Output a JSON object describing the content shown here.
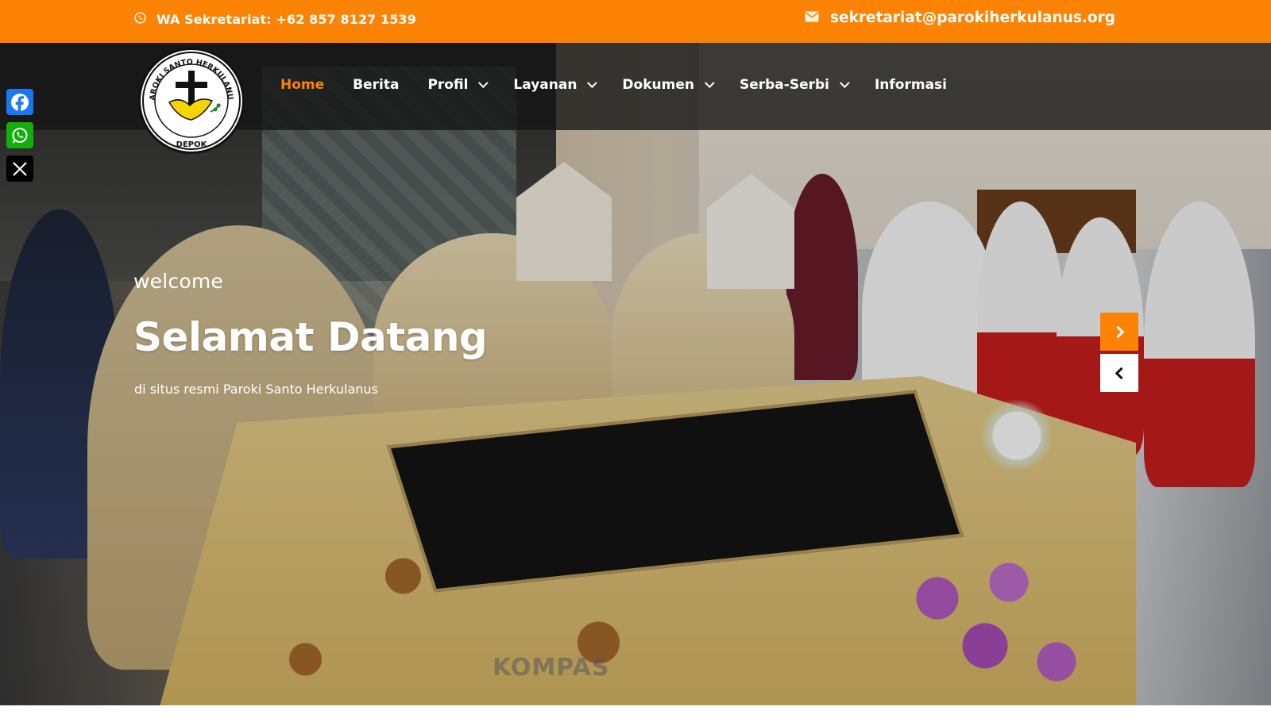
{
  "topbar": {
    "wa_label": "WA Sekretariat: +62 857 8127 1539",
    "email": "sekretariat@parokiherkulanus.org",
    "whatsapp_icon": "whatsapp-icon",
    "mail_icon": "envelope-icon"
  },
  "logo": {
    "text_top": "PAROKI SANTO HERKULANUS",
    "text_bottom": "DEPOK"
  },
  "nav": {
    "items": [
      {
        "label": "Home",
        "active": true,
        "dropdown": false
      },
      {
        "label": "Berita",
        "active": false,
        "dropdown": false
      },
      {
        "label": "Profil",
        "active": false,
        "dropdown": true
      },
      {
        "label": "Layanan",
        "active": false,
        "dropdown": true
      },
      {
        "label": "Dokumen",
        "active": false,
        "dropdown": true
      },
      {
        "label": "Serba-Serbi",
        "active": false,
        "dropdown": true
      },
      {
        "label": "Informasi",
        "active": false,
        "dropdown": false
      }
    ]
  },
  "social": [
    {
      "name": "Facebook",
      "icon": "facebook-icon",
      "color": "#1877f2"
    },
    {
      "name": "WhatsApp",
      "icon": "whatsapp-icon",
      "color": "#12af0a"
    },
    {
      "name": "X",
      "icon": "x-icon",
      "color": "#000000"
    }
  ],
  "hero": {
    "welcome": "welcome",
    "title": "Selamat Datang",
    "subtitle": "di situs resmi Paroki Santo Herkulanus",
    "watermark": "KOMPAS"
  },
  "colors": {
    "accent": "#fd8304",
    "nav_bg": "rgba(20,20,20,0.78)"
  }
}
